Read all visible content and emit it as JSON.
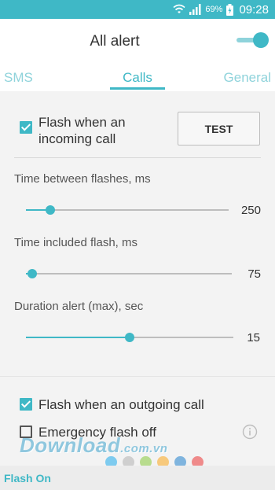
{
  "status_bar": {
    "battery_percent": "69%",
    "time": "09:28",
    "icons": [
      "wifi-icon",
      "signal-icon",
      "battery-charging-icon"
    ]
  },
  "header": {
    "title": "All alert",
    "master_switch_on": true
  },
  "tabs": [
    {
      "label": "SMS",
      "active": false
    },
    {
      "label": "Calls",
      "active": true
    },
    {
      "label": "General",
      "active": false
    }
  ],
  "incoming": {
    "label_line1": "Flash when an",
    "label_line2": "incoming call",
    "checked": true,
    "test_button": "TEST"
  },
  "settings": [
    {
      "label": "Time between flashes, ms",
      "value": "250",
      "position": 0.12
    },
    {
      "label": "Time included flash, ms",
      "value": "75",
      "position": 0.03
    },
    {
      "label": "Duration alert (max), sec",
      "value": "15",
      "position": 0.5
    }
  ],
  "outgoing": {
    "label": "Flash when an outgoing call",
    "checked": true
  },
  "emergency": {
    "label": "Emergency flash off",
    "checked": false
  },
  "watermark": {
    "brand": "Download",
    "ext": ".com.vn"
  },
  "pagination_dots": [
    "#7ecbef",
    "#cfcfcf",
    "#b8dc8e",
    "#f7c97c",
    "#7fb4de",
    "#ef8a8a"
  ],
  "footer": {
    "label": "Flash On"
  },
  "colors": {
    "accent": "#3fb8c6",
    "accent_light": "#8fd3db"
  }
}
